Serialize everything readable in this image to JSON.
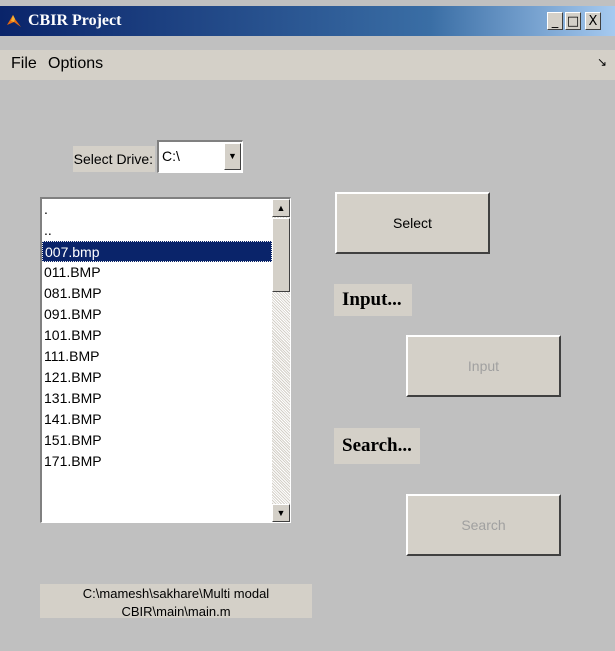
{
  "window": {
    "title": "CBIR Project",
    "controls": {
      "minimize": "_",
      "maximize": "□",
      "close": "X"
    }
  },
  "menu": {
    "file": "File",
    "options": "Options",
    "dock_icon": "↘"
  },
  "drive": {
    "label": "Select Drive:",
    "value": "C:\\"
  },
  "file_list": {
    "items": [
      ".",
      "..",
      "007.bmp",
      "011.BMP",
      "081.BMP",
      "091.BMP",
      "101.BMP",
      "111.BMP",
      "121.BMP",
      "131.BMP",
      "141.BMP",
      "151.BMP",
      "171.BMP"
    ],
    "selected": "007.bmp"
  },
  "buttons": {
    "select": "Select",
    "input": "Input",
    "search": "Search"
  },
  "labels": {
    "input_section": "Input...",
    "search_section": "Search..."
  },
  "path": {
    "line1": "C:\\mamesh\\sakhare\\Multi modal",
    "line2": "CBIR\\main\\main.m"
  }
}
